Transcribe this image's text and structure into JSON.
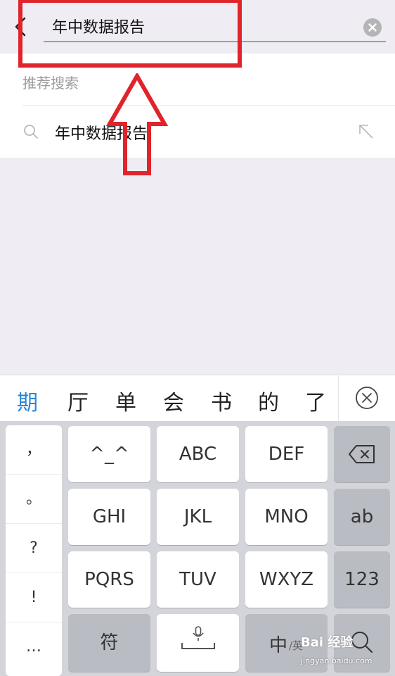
{
  "search": {
    "query": "年中数据报告"
  },
  "suggestions": {
    "header": "推荐搜索",
    "items": [
      {
        "text": "年中数据报告"
      }
    ]
  },
  "candidates": [
    "期",
    "厅",
    "单",
    "会",
    "书",
    "的",
    "了"
  ],
  "keyboard": {
    "punctuation": [
      "，",
      "。",
      "?",
      "!",
      "…"
    ],
    "rows": [
      [
        "^_^",
        "ABC",
        "DEF"
      ],
      [
        "GHI",
        "JKL",
        "MNO"
      ],
      [
        "PQRS",
        "TUV",
        "WXYZ"
      ]
    ],
    "side": {
      "ab": "ab",
      "num": "123"
    },
    "bottom": {
      "symbols": "符",
      "lang_main": "中",
      "lang_sub": "/英"
    }
  },
  "watermark": {
    "logo": "Bai 经验",
    "url": "jingyan.baidu.com"
  },
  "colors": {
    "accent_green": "#6cc16a",
    "candidate_active": "#2a86d6",
    "annotation_red": "#e0242b"
  }
}
